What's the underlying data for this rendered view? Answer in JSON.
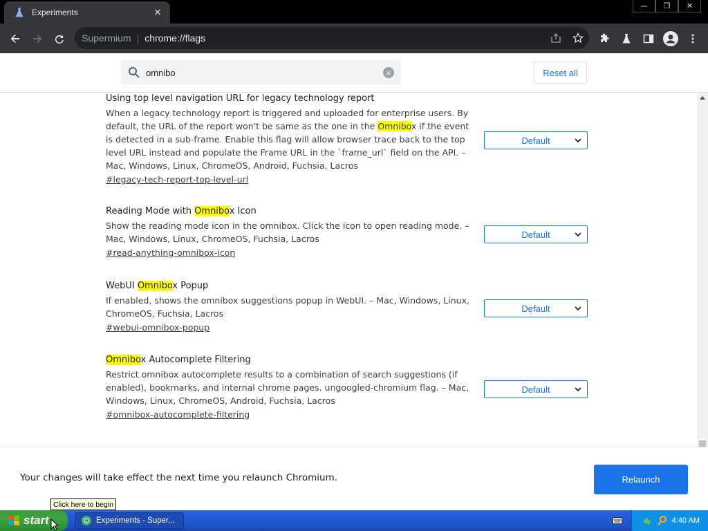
{
  "tab": {
    "title": "Experiments",
    "close": "×"
  },
  "window_buttons": [
    "—",
    "❐",
    "✕"
  ],
  "omnibox": {
    "site": "Supermium",
    "separator": "|",
    "url": "chrome://flags"
  },
  "flags_header": {
    "search_value": "omnibo",
    "clear": "×",
    "reset_label": "Reset all"
  },
  "flags": [
    {
      "name_pre": "Using top level navigation URL for legacy technology report",
      "name_hl": "",
      "name_post": "",
      "desc_pre": "When a legacy technology report is triggered and uploaded for enterprise users. By default, the URL of the report won't be same as the one in the ",
      "desc_hl": "Omnibo",
      "desc_post": "x if the event is detected in a sub-frame. Enable this flag will allow browser trace back to the top level URL instead and populate the Frame URL in the `frame_url` field on the API. – Mac, Windows, Linux, ChromeOS, Android, Fuchsia, Lacros",
      "link": "#legacy-tech-report-top-level-url",
      "select": "Default"
    },
    {
      "name_pre": "Reading Mode with ",
      "name_hl": "Omnibo",
      "name_post": "x Icon",
      "desc_pre": "Show the reading mode icon in the omnibox. Click the icon to open reading mode. – Mac, Windows, Linux, ChromeOS, Fuchsia, Lacros",
      "desc_hl": "",
      "desc_post": "",
      "link": "#read-anything-omnibox-icon",
      "select": "Default"
    },
    {
      "name_pre": "WebUI ",
      "name_hl": "Omnibo",
      "name_post": "x Popup",
      "desc_pre": "If enabled, shows the omnibox suggestions popup in WebUI. – Mac, Windows, Linux, ChromeOS, Fuchsia, Lacros",
      "desc_hl": "",
      "desc_post": "",
      "link": "#webui-omnibox-popup",
      "select": "Default"
    },
    {
      "name_pre": "",
      "name_hl": "Omnibo",
      "name_post": "x Autocomplete Filtering",
      "desc_pre": "Restrict omnibox autocomplete results to a combination of search suggestions (if enabled), bookmarks, and internal chrome pages. ungoogled-chromium flag. – Mac, Windows, Linux, ChromeOS, Android, Fuchsia, Lacros",
      "desc_hl": "",
      "desc_post": "",
      "link": "#omnibox-autocomplete-filtering",
      "select": "Default"
    }
  ],
  "relaunch": {
    "message": "Your changes will take effect the next time you relaunch Chromium.",
    "button": "Relaunch"
  },
  "tooltip": "Click here to begin",
  "taskbar": {
    "start": "start",
    "item": "Experiments - Super...",
    "clock": "4:40 AM"
  },
  "colors": {
    "accent": "#1a73e8",
    "highlight": "#ffff00",
    "taskbar": "#245edb",
    "start": "#3ea13e"
  }
}
